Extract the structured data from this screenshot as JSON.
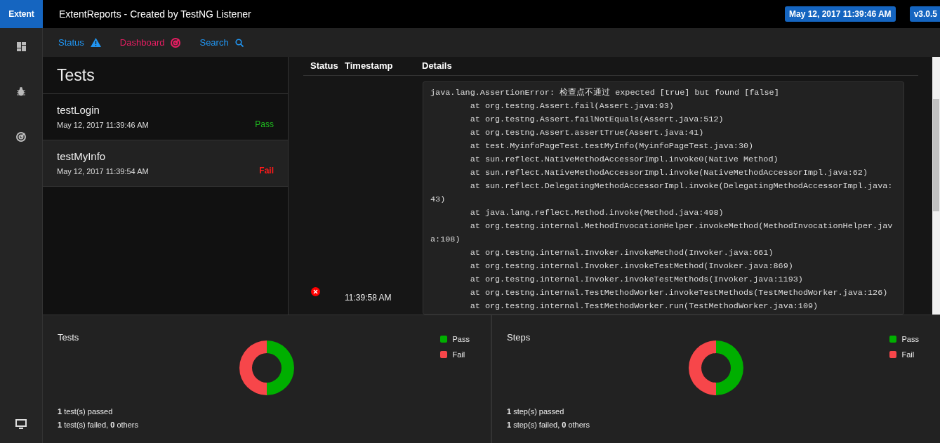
{
  "brand": "Extent",
  "header": {
    "title": "ExtentReports - Created by TestNG Listener",
    "date": "May 12, 2017 11:39:46 AM",
    "version": "v3.0.5"
  },
  "nav": [
    {
      "label": "Status",
      "kind": "status"
    },
    {
      "label": "Dashboard",
      "kind": "dashboard"
    },
    {
      "label": "Search",
      "kind": "search"
    }
  ],
  "tests_panel": {
    "title": "Tests",
    "items": [
      {
        "name": "testLogin",
        "time": "May 12, 2017 11:39:46 AM",
        "status": "Pass",
        "kind": "pass",
        "selected": false
      },
      {
        "name": "testMyInfo",
        "time": "May 12, 2017 11:39:54 AM",
        "status": "Fail",
        "kind": "fail",
        "selected": true
      }
    ]
  },
  "details": {
    "columns": [
      "Status",
      "Timestamp",
      "Details"
    ],
    "rows": [
      {
        "kind": "fail",
        "timestamp": "11:39:58 AM",
        "trace": [
          "java.lang.AssertionError: 检查点不通过 expected [true] but found [false]",
          "\tat org.testng.Assert.fail(Assert.java:93)",
          "\tat org.testng.Assert.failNotEquals(Assert.java:512)",
          "\tat org.testng.Assert.assertTrue(Assert.java:41)",
          "\tat test.MyinfoPageTest.testMyInfo(MyinfoPageTest.java:30)",
          "\tat sun.reflect.NativeMethodAccessorImpl.invoke0(Native Method)",
          "\tat sun.reflect.NativeMethodAccessorImpl.invoke(NativeMethodAccessorImpl.java:62)",
          "\tat sun.reflect.DelegatingMethodAccessorImpl.invoke(DelegatingMethodAccessorImpl.java:43)",
          "\tat java.lang.reflect.Method.invoke(Method.java:498)",
          "\tat org.testng.internal.MethodInvocationHelper.invokeMethod(MethodInvocationHelper.java:108)",
          "\tat org.testng.internal.Invoker.invokeMethod(Invoker.java:661)",
          "\tat org.testng.internal.Invoker.invokeTestMethod(Invoker.java:869)",
          "\tat org.testng.internal.Invoker.invokeTestMethods(Invoker.java:1193)",
          "\tat org.testng.internal.TestMethodWorker.invokeTestMethods(TestMethodWorker.java:126)",
          "\tat org.testng.internal.TestMethodWorker.run(TestMethodWorker.java:109)"
        ]
      }
    ]
  },
  "charts": [
    {
      "title": "Tests",
      "summary": [
        "**1** test(s) passed",
        "**1** test(s) failed, **0** others"
      ],
      "chart_data": {
        "type": "donut",
        "categories": [
          "Pass",
          "Fail"
        ],
        "series": [
          {
            "values": [
              50,
              50
            ]
          }
        ],
        "colors": [
          "#00af00",
          "#f7464a"
        ]
      }
    },
    {
      "title": "Steps",
      "summary": [
        "**1** step(s) passed",
        "**1** step(s) failed, **0** others"
      ],
      "chart_data": {
        "type": "donut",
        "categories": [
          "Pass",
          "Fail"
        ],
        "series": [
          {
            "values": [
              50,
              50
            ]
          }
        ],
        "colors": [
          "#00af00",
          "#f7464a"
        ]
      }
    }
  ]
}
